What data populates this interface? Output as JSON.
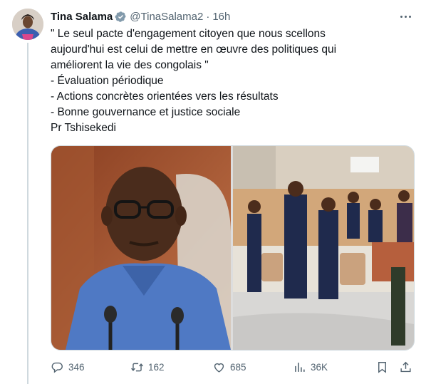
{
  "tweet": {
    "author_name": "Tina Salama",
    "handle": "@TinaSalama2",
    "separator": "·",
    "time": "16h",
    "text_lines": [
      "\" Le seul pacte d'engagement citoyen que nous scellons",
      "aujourd'hui est celui de mettre en œuvre des politiques qui",
      "améliorent la vie des congolais \"",
      "- Évaluation périodique",
      "- Actions concrètes orientées vers les résultats",
      "- Bonne gouvernance et justice sociale",
      "Pr Tshisekedi"
    ]
  },
  "actions": {
    "replies": "346",
    "reposts": "162",
    "likes": "685",
    "views": "36K"
  },
  "icons": {
    "verified": "verified-badge-icon",
    "more": "more-icon",
    "reply": "reply-icon",
    "repost": "repost-icon",
    "like": "heart-icon",
    "views": "views-icon",
    "bookmark": "bookmark-icon",
    "share": "share-icon"
  },
  "colors": {
    "text": "#0f1419",
    "secondary": "#536471",
    "verified": "#829aab",
    "border": "#cfd9de"
  }
}
